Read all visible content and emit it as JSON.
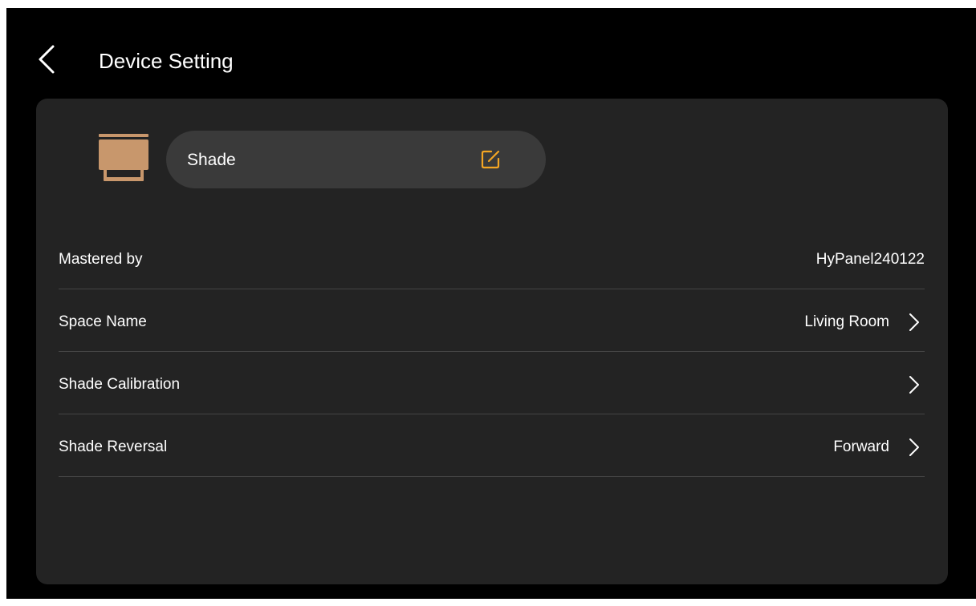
{
  "header": {
    "title": "Device Setting",
    "back_icon": "chevron-left-icon"
  },
  "device": {
    "icon": "shade-icon",
    "name": "Shade",
    "edit_icon": "edit-icon",
    "accent_color": "#f5a623",
    "icon_color": "#c8976c"
  },
  "settings": [
    {
      "label": "Mastered by",
      "value": "HyPanel240122",
      "chevron": false
    },
    {
      "label": "Space Name",
      "value": "Living Room",
      "chevron": true
    },
    {
      "label": "Shade Calibration",
      "value": "",
      "chevron": true
    },
    {
      "label": "Shade Reversal",
      "value": "Forward",
      "chevron": true
    }
  ],
  "colors": {
    "background": "#000000",
    "card": "#232323",
    "pill": "#3a3a3a",
    "divider": "#444444",
    "text": "#ffffff"
  }
}
